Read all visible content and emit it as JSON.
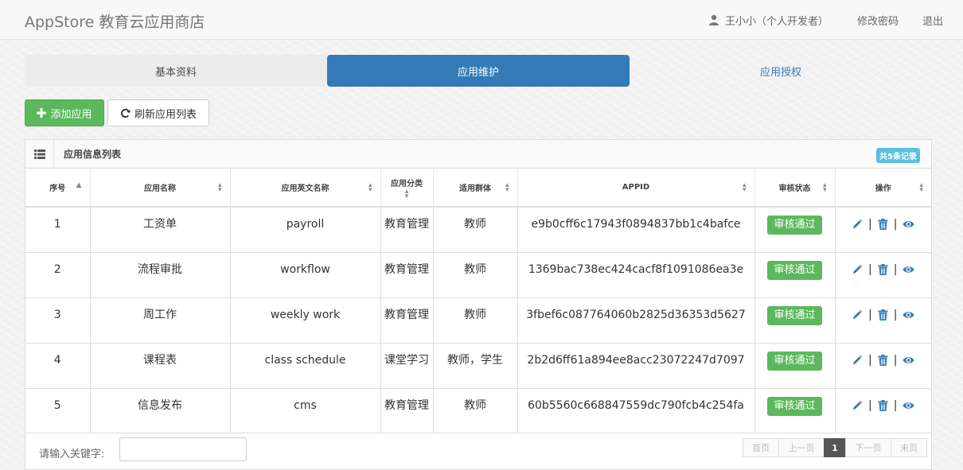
{
  "app_title": "AppStore 教育云应用商店",
  "header": {
    "user": "王小小（个人开发者）",
    "change_password": "修改密码",
    "logout": "退出"
  },
  "tabs": [
    {
      "label": "基本资料"
    },
    {
      "label": "应用维护"
    },
    {
      "label": "应用授权"
    }
  ],
  "toolbar": {
    "add_label": "添加应用",
    "refresh_label": "刷新应用列表"
  },
  "panel": {
    "title": "应用信息列表",
    "badge": "共5条记录"
  },
  "table": {
    "columns": [
      "序号",
      "应用名称",
      "应用英文名称",
      "应用分类",
      "适用群体",
      "APPID",
      "审核状态",
      "操作"
    ],
    "rows": [
      {
        "no": "1",
        "name": "工资单",
        "en_name": "payroll",
        "category": "教育管理",
        "group": "教师",
        "appid": "e9b0cff6c17943f0894837bb1c4bafce",
        "status": "审核通过"
      },
      {
        "no": "2",
        "name": "流程审批",
        "en_name": "workflow",
        "category": "教育管理",
        "group": "教师",
        "appid": "1369bac738ec424cacf8f1091086ea3e",
        "status": "审核通过"
      },
      {
        "no": "3",
        "name": "周工作",
        "en_name": "weekly work",
        "category": "教育管理",
        "group": "教师",
        "appid": "3fbef6c087764060b2825d36353d5627",
        "status": "审核通过"
      },
      {
        "no": "4",
        "name": "课程表",
        "en_name": "class schedule",
        "category": "课堂学习",
        "group": "教师，学生",
        "appid": "2b2d6ff61a894ee8acc23072247d7097",
        "status": "审核通过"
      },
      {
        "no": "5",
        "name": "信息发布",
        "en_name": "cms",
        "category": "教育管理",
        "group": "教师",
        "appid": "60b5560c668847559dc790fcb4c254fa",
        "status": "审核通过"
      }
    ]
  },
  "footer": {
    "search_label": "请输入关键字:",
    "search_value": "",
    "pager": {
      "first": "首页",
      "prev": "上一页",
      "current": "1",
      "next": "下一页",
      "last": "末页"
    }
  },
  "colors": {
    "primary": "#337ab7",
    "success": "#5cb85c",
    "info": "#5bc0de"
  }
}
